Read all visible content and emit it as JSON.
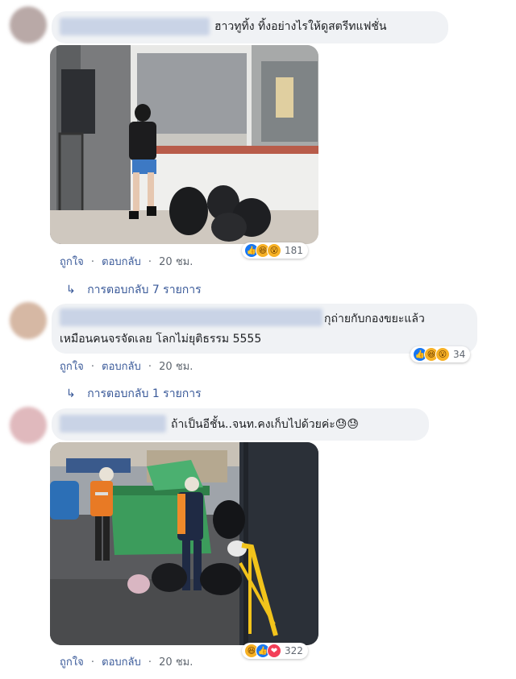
{
  "comments": [
    {
      "text": "ฮาวทูทิ้ง ทิ้งอย่างไรให้ดูสตรีทแฟชั่น",
      "reaction_count": "181",
      "reactions": [
        "like-reaction-icon",
        "haha-reaction-icon",
        "wow-reaction-icon"
      ],
      "actions": {
        "like": "ถูกใจ",
        "reply": "ตอบกลับ",
        "time": "20 ชม."
      },
      "replies_label": "การตอบกลับ 7 รายการ",
      "reply_arrow": "↳"
    },
    {
      "text_line1": "กุถ่ายกับกองขยะแล้ว",
      "text_line2": "เหมือนคนจรจัดเลย โลกไม่ยุติธรรม 5555",
      "reaction_count": "34",
      "reactions": [
        "like-reaction-icon",
        "haha-reaction-icon",
        "wow-reaction-icon"
      ],
      "actions": {
        "like": "ถูกใจ",
        "reply": "ตอบกลับ",
        "time": "20 ชม."
      },
      "replies_label": "การตอบกลับ 1 รายการ",
      "reply_arrow": "↳"
    },
    {
      "text": "ถ้าเป็นอีชั้น..จนท.คงเก็บไปด้วยค่ะ😓😓",
      "reaction_count": "322",
      "reactions": [
        "haha-reaction-icon",
        "like-reaction-icon",
        "love-reaction-icon"
      ],
      "actions": {
        "like": "ถูกใจ",
        "reply": "ตอบกลับ",
        "time": "20 ชม."
      }
    }
  ],
  "separator": "·",
  "colors": {
    "link": "#385898",
    "bubble": "#f0f2f5",
    "like": "#1877f2",
    "haha": "#f7b125",
    "love": "#f33e58"
  }
}
